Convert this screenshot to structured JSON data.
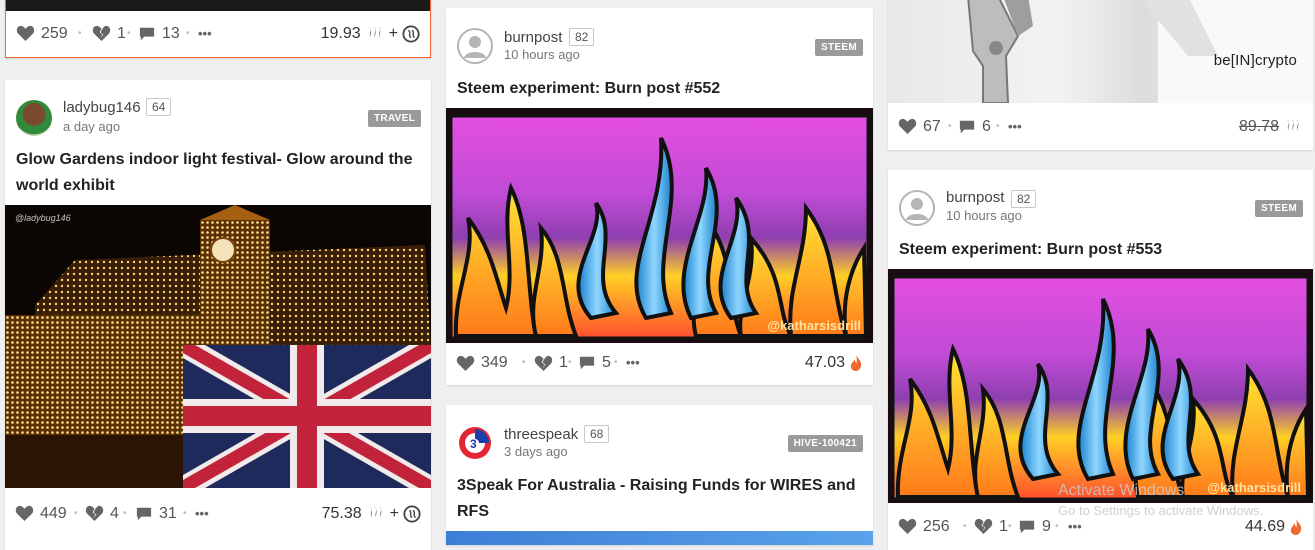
{
  "cards": {
    "top_left": {
      "likes": "259",
      "flags": "1",
      "comments": "13",
      "payout": "19.93",
      "plus": "+"
    },
    "ladybug": {
      "author": "ladybug146",
      "rep": "64",
      "time": "a day ago",
      "tag": "TRAVEL",
      "title": "Glow Gardens indoor light festival- Glow around the world exhibit",
      "image_caption": "@ladybug146",
      "likes": "449",
      "flags": "4",
      "comments": "31",
      "payout": "75.38",
      "plus": "+"
    },
    "burn552": {
      "author": "burnpost",
      "rep": "82",
      "time": "10 hours ago",
      "tag": "STEEM",
      "title": "Steem experiment: Burn post #552",
      "image_caption": "@katharsisdrill",
      "likes": "349",
      "flags": "1",
      "comments": "5",
      "payout": "47.03"
    },
    "threespeak": {
      "author": "threespeak",
      "rep": "68",
      "time": "3 days ago",
      "tag": "HIVE-100421",
      "title": "3Speak For Australia - Raising Funds for WIRES and RFS"
    },
    "top_right": {
      "brand_text": "be[IN]crypto",
      "likes": "67",
      "comments": "6",
      "payout": "89.78"
    },
    "burn553": {
      "author": "burnpost",
      "rep": "82",
      "time": "10 hours ago",
      "tag": "STEEM",
      "title": "Steem experiment: Burn post #553",
      "image_caption": "@katharsisdrill",
      "likes": "256",
      "flags": "1",
      "comments": "9",
      "payout": "44.69"
    }
  },
  "os_notice": {
    "title": "Activate Windows",
    "subtitle": "Go to Settings to activate Windows."
  },
  "menu_glyph": "•••",
  "colors": {
    "accent_orange": "#f0682e",
    "fire_orange": "#f0682e",
    "tag_gray": "#9a9a9a"
  }
}
